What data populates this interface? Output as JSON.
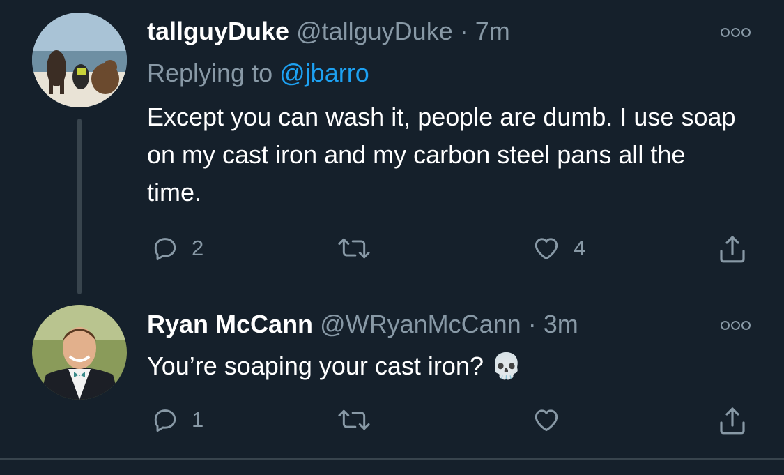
{
  "tweets": [
    {
      "name": "tallguyDuke",
      "handle": "@tallguyDuke",
      "separator": "·",
      "time": "7m",
      "replying_prefix": "Replying to",
      "replying_to": "@jbarro",
      "text": "Except you can wash it, people are dumb. I use soap on my cast iron and my carbon steel pans all the time.",
      "reply_count": "2",
      "retweet_count": "",
      "like_count": "4"
    },
    {
      "name": "Ryan McCann",
      "handle": "@WRyanMcCann",
      "separator": "·",
      "time": "3m",
      "text": "You’re soaping your cast iron? 💀",
      "reply_count": "1",
      "retweet_count": "",
      "like_count": ""
    }
  ],
  "icons": {
    "reply": "reply-icon",
    "retweet": "retweet-icon",
    "like": "heart-icon",
    "share": "share-icon",
    "more": "more-icon"
  },
  "colors": {
    "background": "#15202b",
    "secondary_text": "#8899a6",
    "link": "#1da1f2",
    "thread_line": "#38444d"
  }
}
